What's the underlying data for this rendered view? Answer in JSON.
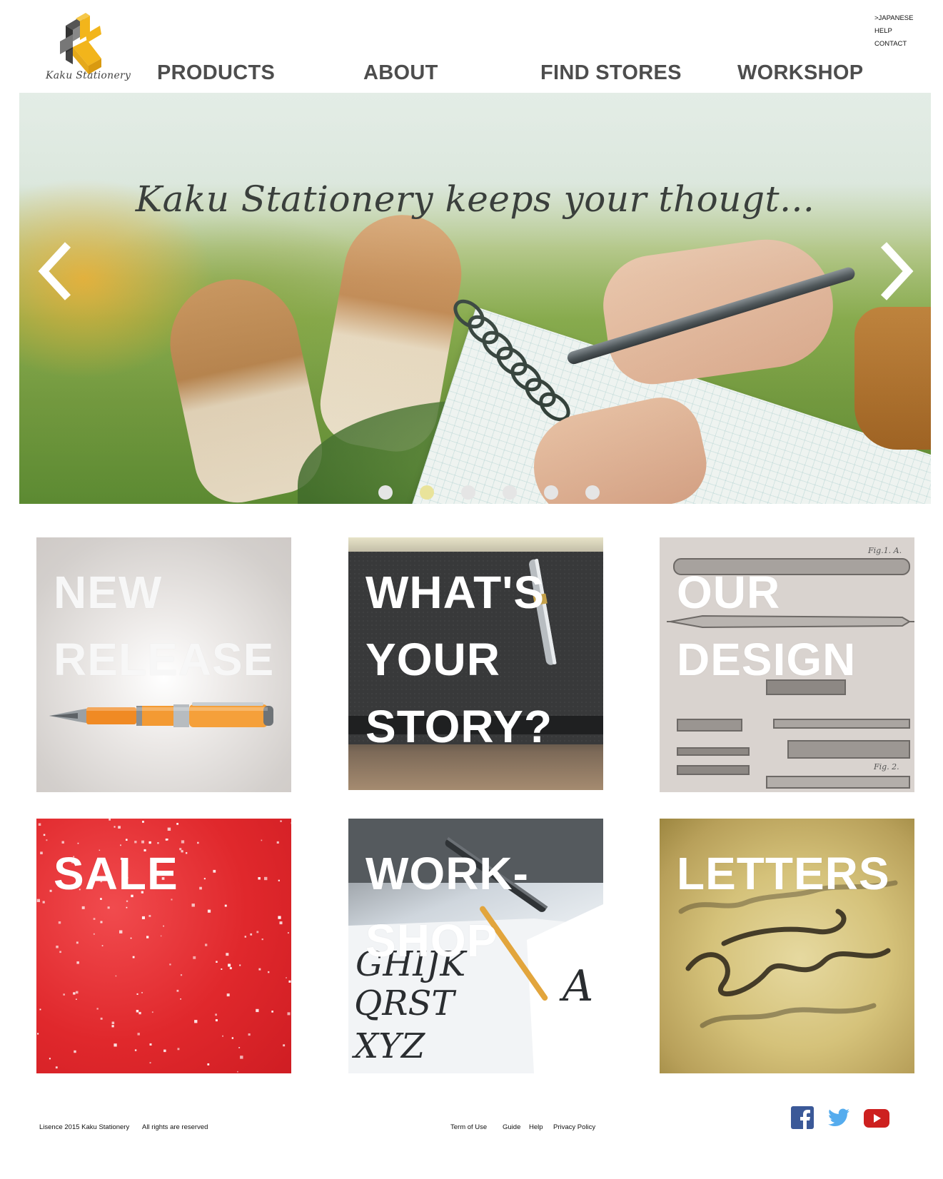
{
  "brand": {
    "name": "Kaku Stationery"
  },
  "utility_links": [
    ">JAPANESE",
    "HELP",
    "CONTACT"
  ],
  "nav": {
    "products": "PRODUCTS",
    "about": "ABOUT",
    "find_stores": "FIND STORES",
    "workshop": "WORKSHOP"
  },
  "hero": {
    "tagline": "Kaku Stationery keeps your thougt...",
    "slide_count": 6,
    "active_slide": 2
  },
  "tiles": {
    "new_release": [
      "NEW",
      "RELEASE"
    ],
    "story": [
      "WHAT'S",
      "YOUR",
      "STORY?"
    ],
    "design": [
      "OUR",
      "DESIGN"
    ],
    "design_fig1": "Fig.1. A.",
    "design_fig2": "Fig. 2.",
    "sale": [
      "SALE"
    ],
    "workshop": [
      "WORK-",
      "SHOP"
    ],
    "letters": [
      "LETTERS"
    ]
  },
  "footer": {
    "licence": "Lisence 2015 Kaku Stationery",
    "rights": "All rights are reserved",
    "links": [
      "Term of Use",
      "Guide",
      "Help",
      "Privacy Policy"
    ]
  },
  "social": [
    "facebook-icon",
    "twitter-icon",
    "youtube-icon"
  ],
  "colors": {
    "logo_yellow": "#f2b51b",
    "facebook": "#3b5998",
    "twitter": "#55acee",
    "youtube": "#cd201f",
    "dot_active": "#e9e39a"
  }
}
